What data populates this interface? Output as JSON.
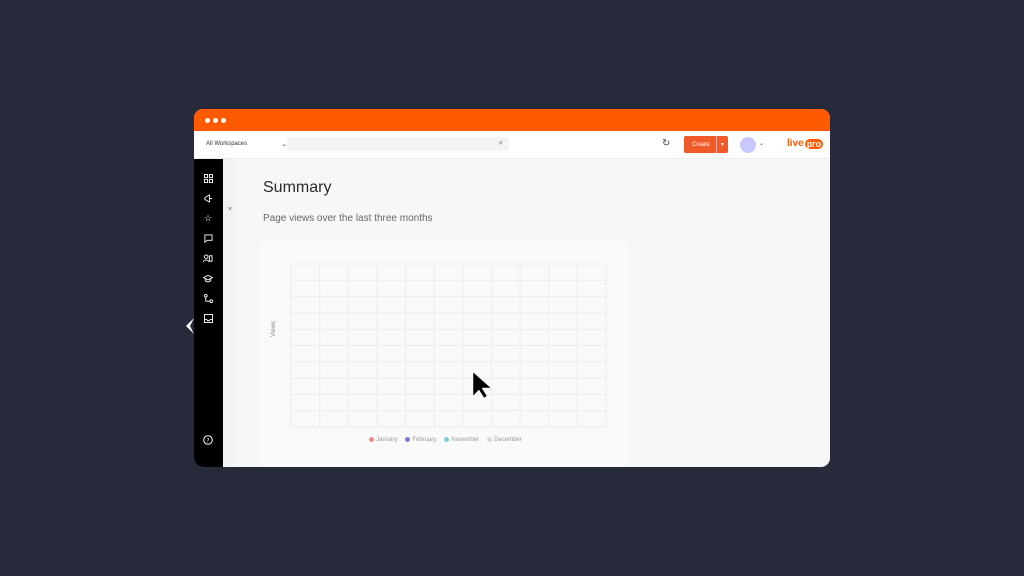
{
  "topbar": {
    "workspace": "All Workspaces",
    "create_label": "Create",
    "logo_live": "live",
    "logo_pro": "pro"
  },
  "main": {
    "title": "Summary",
    "subtitle": "Page views over the last three months"
  },
  "colors": {
    "brand": "#ff5a00",
    "create": "#f05a28",
    "sidebar": "#000000"
  },
  "sidebar": {
    "icons": [
      "grid-icon",
      "megaphone-icon",
      "star-icon",
      "message-icon",
      "users-icon",
      "graduation-icon",
      "workflow-icon",
      "inbox-icon",
      "help-icon"
    ]
  },
  "chart_data": {
    "type": "line",
    "ylabel": "Views",
    "series": [
      {
        "name": "January",
        "color": "#f28a8a"
      },
      {
        "name": "February",
        "color": "#7a7ad8"
      },
      {
        "name": "November",
        "color": "#7ed0cf"
      },
      {
        "name": "December",
        "color": "#e5d4d8"
      }
    ]
  }
}
